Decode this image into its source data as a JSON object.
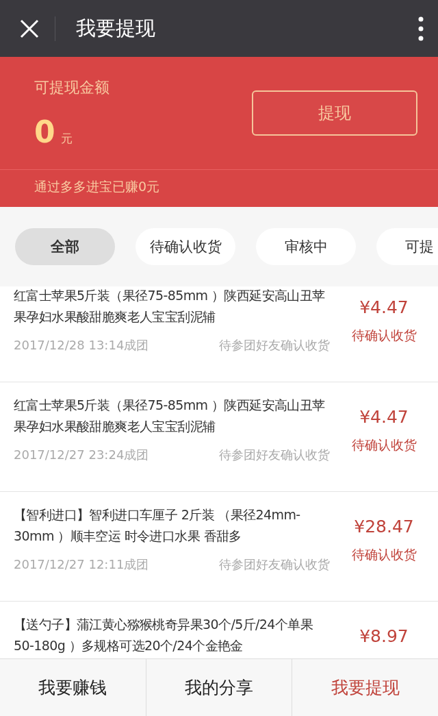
{
  "header": {
    "title": "我要提现"
  },
  "balance": {
    "label": "可提现金额",
    "amount": "0",
    "unit": "元",
    "button": "提现",
    "earned": "通过多多进宝已赚0元"
  },
  "tabs": [
    {
      "label": "全部",
      "selected": true
    },
    {
      "label": "待确认收货",
      "selected": false
    },
    {
      "label": "审核中",
      "selected": false
    },
    {
      "label": "可提",
      "selected": false
    }
  ],
  "orders": [
    {
      "title": "红富士苹果5斤装（果径75-85mm ）陕西延安高山丑苹果孕妇水果酸甜脆爽老人宝宝刮泥辅",
      "price": "¥4.47",
      "status": "待确认收货",
      "date": "2017/12/28 13:14成团",
      "note": "待参团好友确认收货"
    },
    {
      "title": "红富士苹果5斤装（果径75-85mm ）陕西延安高山丑苹果孕妇水果酸甜脆爽老人宝宝刮泥辅",
      "price": "¥4.47",
      "status": "待确认收货",
      "date": "2017/12/27 23:24成团",
      "note": "待参团好友确认收货"
    },
    {
      "title": "【智利进口】智利进口车厘子 2斤装 （果径24mm-30mm ）顺丰空运 时令进口水果 香甜多",
      "price": "¥28.47",
      "status": "待确认收货",
      "date": "2017/12/27 12:11成团",
      "note": "待参团好友确认收货"
    },
    {
      "title": "【送勺子】蒲江黄心猕猴桃奇异果30个/5斤/24个单果50-180g ）多规格可选20个/24个金艳金",
      "price": "¥8.97"
    }
  ],
  "nav": [
    {
      "label": "我要赚钱",
      "selected": false
    },
    {
      "label": "我的分享",
      "selected": false
    },
    {
      "label": "我要提现",
      "selected": true
    }
  ]
}
